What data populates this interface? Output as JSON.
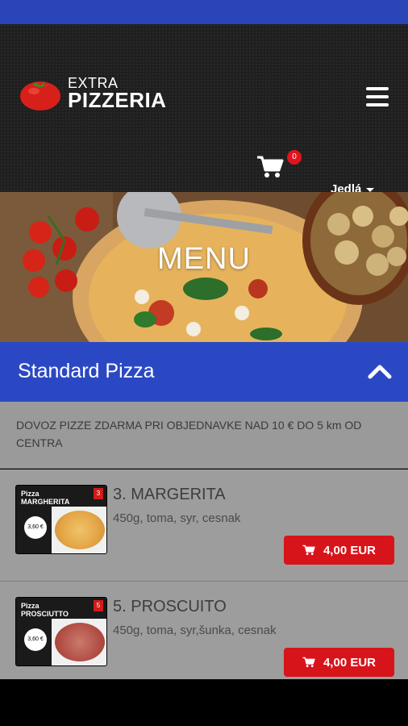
{
  "brand": {
    "line1": "EXTRA",
    "line2": "PIZZERIA"
  },
  "header": {
    "cart_count": "0",
    "language": "Jedlá"
  },
  "hero": {
    "title": "MENU"
  },
  "section": {
    "title": "Standard Pizza"
  },
  "notice": {
    "text": "DOVOZ PIZZE ZDARMA PRI OBJEDNAVKE NAD 10 € DO 5 km OD CENTRA"
  },
  "items": [
    {
      "name": "3. MARGERITA",
      "desc": "450g, toma, syr, cesnak",
      "price": "4,00 EUR",
      "thumb_label": "Pizza\nMARGHERITA",
      "thumb_price": "3,60 €",
      "thumb_badge": "3"
    },
    {
      "name": "5. PROSCUITO",
      "desc": "450g, toma, syr,šunka, cesnak",
      "price": "4,00 EUR",
      "thumb_label": "Pizza\nPROSCIUTTO",
      "thumb_price": "3,60 €",
      "thumb_badge": "5"
    }
  ],
  "colors": {
    "accent_blue": "#2b48c4",
    "price_red": "#d8141b",
    "header_dark": "#1f1f1f"
  }
}
